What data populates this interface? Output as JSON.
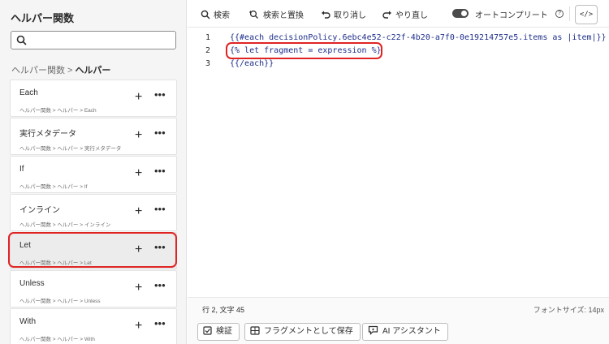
{
  "sidebar": {
    "title": "ヘルパー関数",
    "search": {
      "value": "",
      "placeholder": ""
    },
    "breadcrumb": {
      "parent": "ヘルパー関数",
      "separator": ">",
      "current": "ヘルパー"
    },
    "items": [
      {
        "name": "Each",
        "path": "ヘルパー関数 > ヘルパー > Each"
      },
      {
        "name": "実行メタデータ",
        "path": "ヘルパー関数 > ヘルパー > 実行メタデータ"
      },
      {
        "name": "If",
        "path": "ヘルパー関数 > ヘルパー > If"
      },
      {
        "name": "インライン",
        "path": "ヘルパー関数 > ヘルパー > インライン"
      },
      {
        "name": "Let",
        "path": "ヘルパー関数 > ヘルパー > Let"
      },
      {
        "name": "Unless",
        "path": "ヘルパー関数 > ヘルパー > Unless"
      },
      {
        "name": "With",
        "path": "ヘルパー関数 > ヘルパー > With"
      }
    ],
    "add_symbol": "+",
    "more_symbol": "•••"
  },
  "toolbar": {
    "search_label": "検索",
    "search_replace_label": "検索と置換",
    "undo_label": "取り消し",
    "redo_label": "やり直し",
    "autocomplete_label": "オートコンプリート",
    "autocomplete_on": true,
    "help_symbol": "?",
    "code_view_symbol": "</>"
  },
  "editor": {
    "lines": [
      {
        "number": "1",
        "text": "{{#each decisionPolicy.6ebc4e52-c22f-4b20-a7f0-0e19214757e5.items as |item|}}"
      },
      {
        "number": "2",
        "text": "{% let fragment = expression %}"
      },
      {
        "number": "3",
        "text": "{{/each}}"
      }
    ]
  },
  "status": {
    "cursor_position": "行 2, 文字 45",
    "font_size": "フォントサイズ: 14px"
  },
  "actions": {
    "validate_label": "検証",
    "save_fragment_label": "フラグメントとして保存",
    "ai_assistant_label": "AI アシスタント"
  },
  "colors": {
    "highlight": "#e02424",
    "code_text": "#1f2f8a"
  }
}
